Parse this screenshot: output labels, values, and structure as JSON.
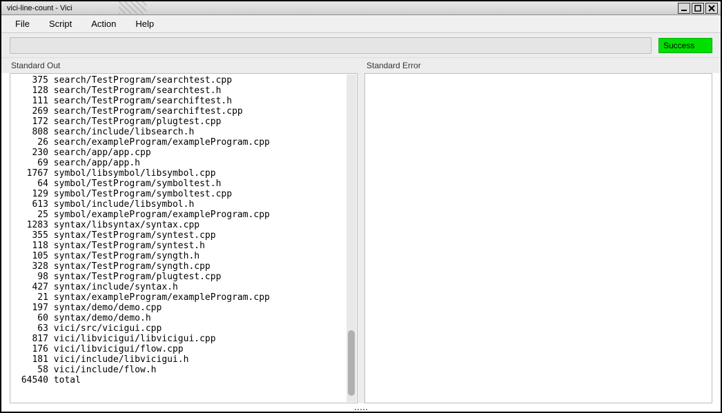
{
  "window": {
    "title": "vici-line-count - Vici"
  },
  "menu": {
    "file": "File",
    "script": "Script",
    "action": "Action",
    "help": "Help"
  },
  "toolbar": {
    "command_value": "",
    "status": "Success"
  },
  "labels": {
    "stdout": "Standard Out",
    "stderr": "Standard Error"
  },
  "stdout_lines": [
    {
      "count": 375,
      "path": "search/TestProgram/searchtest.cpp"
    },
    {
      "count": 128,
      "path": "search/TestProgram/searchtest.h"
    },
    {
      "count": 111,
      "path": "search/TestProgram/searchiftest.h"
    },
    {
      "count": 269,
      "path": "search/TestProgram/searchiftest.cpp"
    },
    {
      "count": 172,
      "path": "search/TestProgram/plugtest.cpp"
    },
    {
      "count": 808,
      "path": "search/include/libsearch.h"
    },
    {
      "count": 26,
      "path": "search/exampleProgram/exampleProgram.cpp"
    },
    {
      "count": 230,
      "path": "search/app/app.cpp"
    },
    {
      "count": 69,
      "path": "search/app/app.h"
    },
    {
      "count": 1767,
      "path": "symbol/libsymbol/libsymbol.cpp"
    },
    {
      "count": 64,
      "path": "symbol/TestProgram/symboltest.h"
    },
    {
      "count": 129,
      "path": "symbol/TestProgram/symboltest.cpp"
    },
    {
      "count": 613,
      "path": "symbol/include/libsymbol.h"
    },
    {
      "count": 25,
      "path": "symbol/exampleProgram/exampleProgram.cpp"
    },
    {
      "count": 1283,
      "path": "syntax/libsyntax/syntax.cpp"
    },
    {
      "count": 355,
      "path": "syntax/TestProgram/syntest.cpp"
    },
    {
      "count": 118,
      "path": "syntax/TestProgram/syntest.h"
    },
    {
      "count": 105,
      "path": "syntax/TestProgram/syngth.h"
    },
    {
      "count": 328,
      "path": "syntax/TestProgram/syngth.cpp"
    },
    {
      "count": 98,
      "path": "syntax/TestProgram/plugtest.cpp"
    },
    {
      "count": 427,
      "path": "syntax/include/syntax.h"
    },
    {
      "count": 21,
      "path": "syntax/exampleProgram/exampleProgram.cpp"
    },
    {
      "count": 197,
      "path": "syntax/demo/demo.cpp"
    },
    {
      "count": 60,
      "path": "syntax/demo/demo.h"
    },
    {
      "count": 63,
      "path": "vici/src/vicigui.cpp"
    },
    {
      "count": 817,
      "path": "vici/libvicigui/libvicigui.cpp"
    },
    {
      "count": 176,
      "path": "vici/libvicigui/flow.cpp"
    },
    {
      "count": 181,
      "path": "vici/include/libvicigui.h"
    },
    {
      "count": 58,
      "path": "vici/include/flow.h"
    },
    {
      "count": 64540,
      "path": "total"
    }
  ],
  "stderr_text": ""
}
